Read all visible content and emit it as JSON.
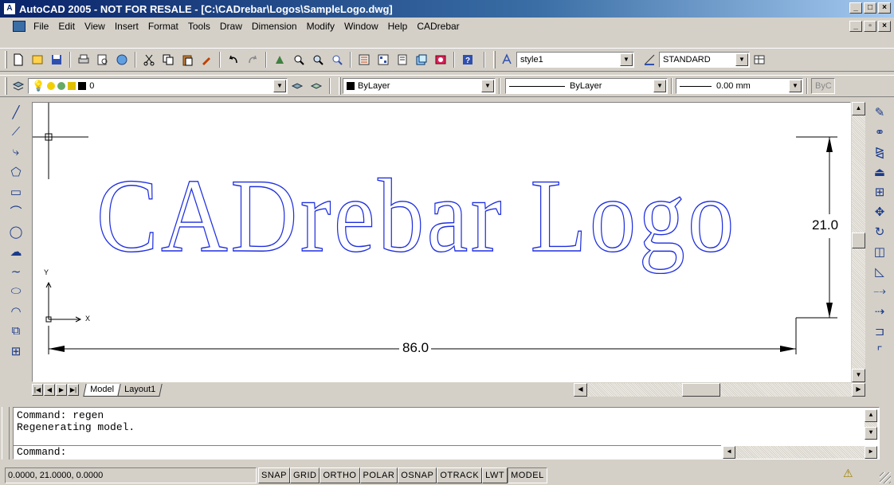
{
  "window": {
    "title": "AutoCAD 2005 - NOT FOR RESALE - [C:\\CADrebar\\Logos\\SampleLogo.dwg]",
    "app_icon_glyph": "A",
    "controls": [
      "_",
      "□",
      "×"
    ],
    "doc_controls": [
      "_",
      "▫",
      "×"
    ]
  },
  "menu": [
    "File",
    "Edit",
    "View",
    "Insert",
    "Format",
    "Tools",
    "Draw",
    "Dimension",
    "Modify",
    "Window",
    "Help",
    "CADrebar"
  ],
  "standard_toolbar": {
    "text_style": "style1",
    "dim_style": "STANDARD"
  },
  "layer_toolbar": {
    "layer_name": "0",
    "color": "ByLayer",
    "linetype": "ByLayer",
    "lineweight": "0.00 mm",
    "plotstyle": "ByC"
  },
  "drawing": {
    "logo_text": "CADrebar Logo",
    "logo_color": "#1f2fe0",
    "dim_horizontal": "86.0",
    "dim_vertical": "21.0",
    "ucs_x": "X",
    "ucs_y": "Y"
  },
  "tabs": {
    "model": "Model",
    "layout": "Layout1"
  },
  "command": {
    "history": [
      "Command: regen",
      "Regenerating model."
    ],
    "prompt": "Command:"
  },
  "status": {
    "coords": "0.0000, 21.0000, 0.0000",
    "toggles": [
      "SNAP",
      "GRID",
      "ORTHO",
      "POLAR",
      "OSNAP",
      "OTRACK",
      "LWT",
      "MODEL"
    ]
  },
  "icons": {
    "left_toolbar": [
      "line-icon",
      "construction-line-icon",
      "polyline-icon",
      "polygon-icon",
      "rectangle-icon",
      "arc-icon",
      "circle-icon",
      "revision-cloud-icon",
      "spline-icon",
      "ellipse-icon",
      "ellipse-arc-icon",
      "insert-block-icon",
      "make-block-icon"
    ],
    "right_toolbar": [
      "erase-icon",
      "copy-icon",
      "mirror-icon",
      "offset-icon",
      "array-icon",
      "move-icon",
      "rotate-icon",
      "scale-icon",
      "stretch-icon",
      "trim-icon",
      "extend-icon",
      "break-icon",
      "chamfer-icon"
    ]
  }
}
